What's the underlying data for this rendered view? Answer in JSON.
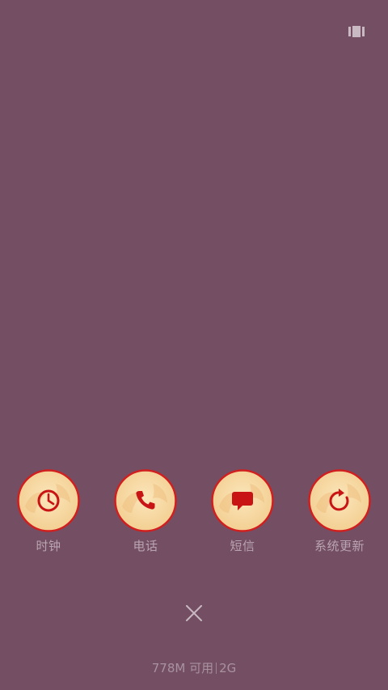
{
  "top_bar": {
    "recents_toggle_icon": "card-view-icon"
  },
  "apps": [
    {
      "label": "时钟",
      "icon": "clock-icon"
    },
    {
      "label": "电话",
      "icon": "phone-icon"
    },
    {
      "label": "短信",
      "icon": "message-icon"
    },
    {
      "label": "系统更新",
      "icon": "refresh-icon"
    }
  ],
  "close_button": {
    "icon": "close-icon"
  },
  "memory_status": {
    "available": "778M 可用",
    "total": "2G"
  },
  "colors": {
    "background": "#744e63",
    "icon_fill": "#f7d9a3",
    "icon_ring": "#d11f1f",
    "label_text": "#b9a4b1"
  }
}
